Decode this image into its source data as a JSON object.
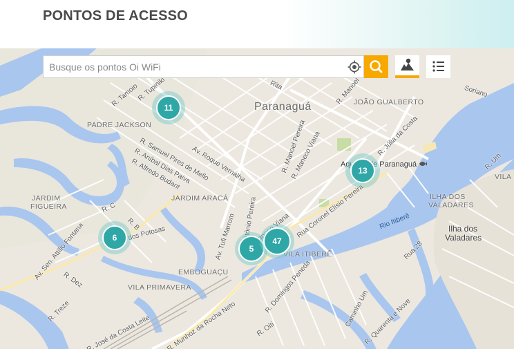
{
  "header": {
    "title": "PONTOS DE ACESSO"
  },
  "search": {
    "placeholder": "Busque os pontos Oi WiFi"
  },
  "toolbar": {
    "locate_icon": "crosshair-icon",
    "search_icon": "search-icon",
    "map_view_icon": "map-icon",
    "list_view_icon": "list-icon",
    "accent_color": "#f7a900"
  },
  "clusters": [
    {
      "count": "11"
    },
    {
      "count": "13"
    },
    {
      "count": "6"
    },
    {
      "count": "5"
    },
    {
      "count": "47"
    }
  ],
  "map_labels": {
    "city": "Paranaguá",
    "city2": "Ilha dos",
    "city2b": "Valadares",
    "joao": "JOÃO GUALBERTO",
    "padre": "PADRE JACKSON",
    "figueira1": "JARDIM",
    "figueira2": "FIGUEIRA",
    "araca": "JARDIM ARACÁ",
    "emboguacu": "EMBOGUAÇU",
    "primavera": "VILA PRIMAVERA",
    "itibere": "VILA ITIBERÊ",
    "valadares1": "ILHA DOS",
    "valadares2": "VALADARES",
    "vila": "VILA",
    "aquario": "Aquário de Paranaguá",
    "rio": "Rio Itiberê",
    "r_tamoio": "R. Tamoio",
    "r_tupinik": "R. Tupiniki",
    "r_samuel": "R. Samuel Pires de Mello",
    "r_anibal": "R. Aníbal Dias Paiva",
    "r_alfredo": "R. Alfredo Budant",
    "av_roque": "Av. Roque Vernalha",
    "r_manoel": "R. Manoel Pereira",
    "r_maneco": "R. Maneco Viana",
    "r_julia": "R. Júlia da Costa",
    "r_manoel2": "R. Manoel",
    "r_coronel": "Rua Coronel Elísio Pereira",
    "r_antonio": "R. Antônio Pereira",
    "r_maneco2": "R. Maneco Viana",
    "av_tufi": "Av. Tufi Marrom",
    "r_munhoz": "R. Munhoz da Rocha Neto",
    "r_domingos": "R. Domingos Peneda",
    "r_costa": "R. José da Costa Leite",
    "r_treze": "R. Treze",
    "r_dez": "R. Dez",
    "av_sen": "Av. Sen. Attílio Fontana",
    "r_c": "R. C",
    "r_b": "R. B",
    "r_28": "Rua 28",
    "r_caminho": "Caminho Um",
    "r_quarenta": "R. Quarenta e Nove",
    "r_um": "R. Um",
    "r_oiti": "R. Oiti",
    "r_rita": "Rita",
    "r_soriano": "Soriano",
    "r_do_potosas": "R. dos Potosas"
  }
}
